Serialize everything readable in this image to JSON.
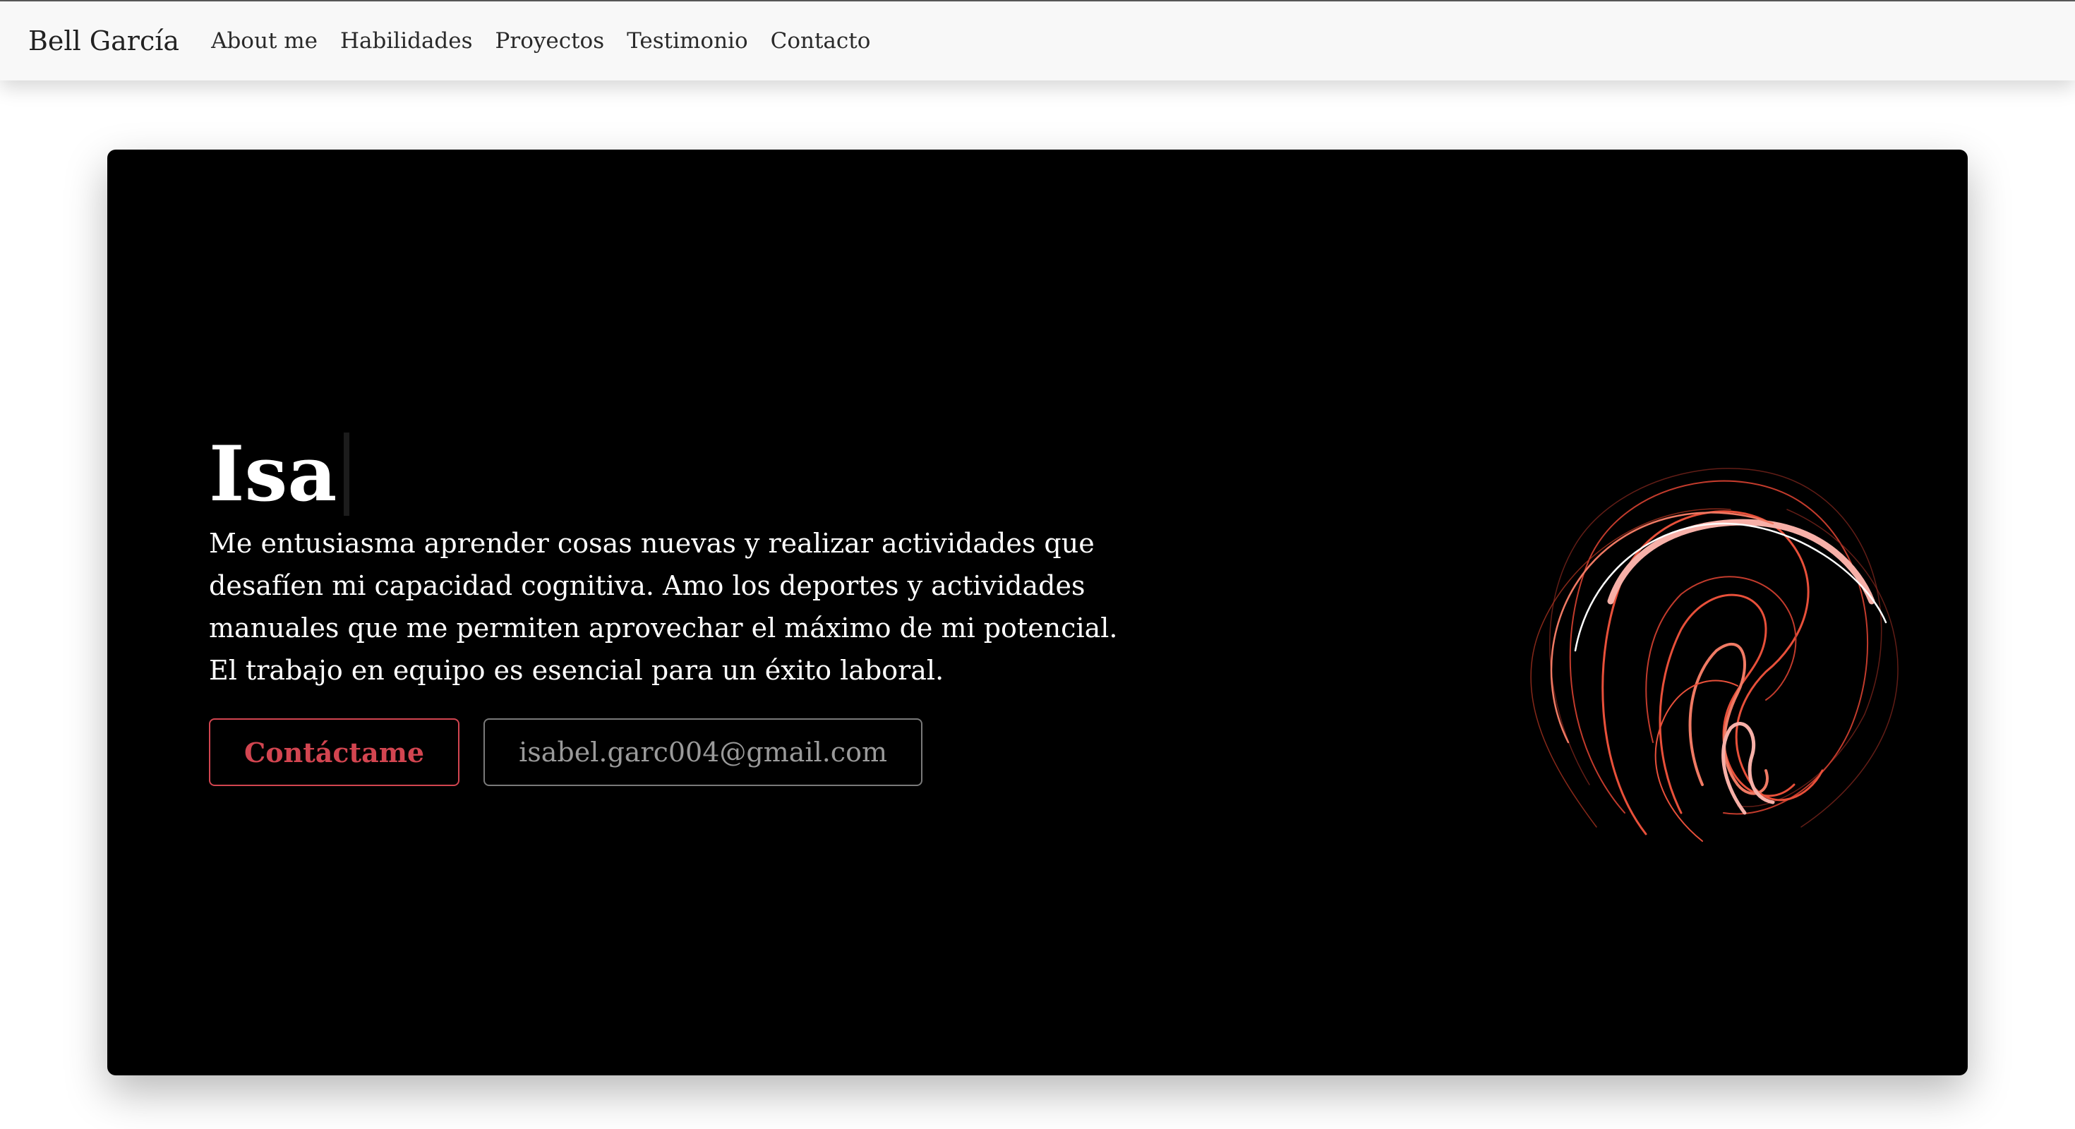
{
  "navbar": {
    "brand": "Bell García",
    "links": [
      "About me",
      "Habilidades",
      "Proyectos",
      "Testimonio",
      "Contacto"
    ]
  },
  "hero": {
    "title": "Isa",
    "description": "Me entusiasma aprender cosas nuevas y realizar actividades que desafíen mi capacidad cognitiva. Amo los deportes y actividades manuales que me permiten aprovechar el máximo de mi potencial. El trabajo en equipo es esencial para un éxito laboral.",
    "contact_button": "Contáctame",
    "email_button": "isabel.garc004@gmail.com"
  },
  "colors": {
    "accent": "#d24550",
    "hero_background": "#000000",
    "navbar_background": "#f8f8f8",
    "swirl_primary": "#e8503a",
    "swirl_light": "#f7b0a8"
  },
  "icons": {
    "hero_graphic": "red-line-swirl"
  }
}
